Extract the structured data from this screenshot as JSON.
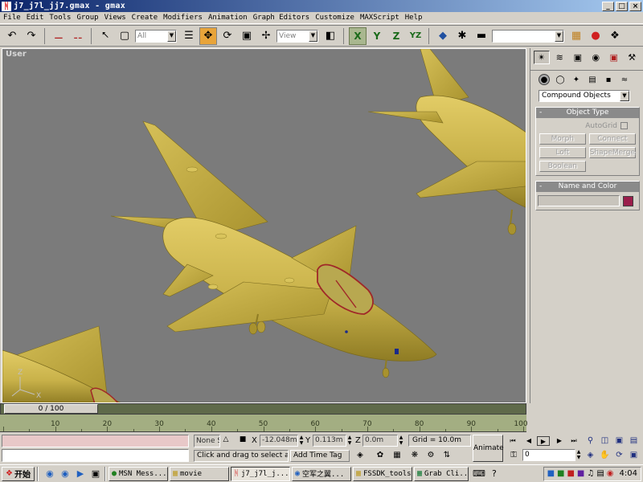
{
  "window": {
    "title": "j7_j7l_jj7.gmax - gmax",
    "minimize": "_",
    "maximize": "□",
    "close": "×"
  },
  "menu": [
    "File",
    "Edit",
    "Tools",
    "Group",
    "Views",
    "Create",
    "Modifiers",
    "Animation",
    "Graph Editors",
    "Customize",
    "MAXScript",
    "Help"
  ],
  "toolbar": {
    "filter_value": "All",
    "refcoord_value": "View",
    "axis_x": "X",
    "axis_y": "Y",
    "axis_z": "Z",
    "axis_yz": "YZ"
  },
  "viewport": {
    "label": "User",
    "axis_x": "X",
    "axis_z": "Z",
    "colors": {
      "background": "#7b7b7b",
      "aircraft": "#c9b24a",
      "aircraft_shadow": "#8f7c24",
      "canopy": "#a02828",
      "marking": "#1a2a8a"
    }
  },
  "command_panel": {
    "category": "Compound Objects",
    "object_type": {
      "title": "Object Type",
      "autogrid": "AutoGrid",
      "buttons": [
        "Morph",
        "Connect",
        "Loft",
        "ShapeMerge",
        "Boolean"
      ]
    },
    "name_color": {
      "title": "Name and Color",
      "name_value": "",
      "color": "#9a1d4a"
    }
  },
  "timeslider": {
    "current": 0,
    "end": 100,
    "label": "0 / 100",
    "ticks": [
      10,
      20,
      30,
      40,
      50,
      60,
      70,
      80,
      90,
      100
    ]
  },
  "status": {
    "selection": "None S",
    "x_label": "X",
    "x_value": "-12.048m",
    "y_label": "Y",
    "y_value": "0.113m",
    "z_label": "Z",
    "z_value": "0.0m",
    "grid": "Grid = 10.0m",
    "prompt": "Click and drag to select and m",
    "time_tag": "Add Time Tag",
    "animate": "Animate",
    "frame_value": "0"
  },
  "taskbar": {
    "start": "开始",
    "tasks": [
      {
        "label": "MSN Mess...",
        "icon": "msn-icon",
        "active": false
      },
      {
        "label": "movie",
        "icon": "folder-icon",
        "active": false
      },
      {
        "label": "j7_j7l_j...",
        "icon": "gmax-icon",
        "active": true
      },
      {
        "label": "空军之翼...",
        "icon": "browser-icon",
        "active": false
      },
      {
        "label": "FSSDK_tools",
        "icon": "folder-icon",
        "active": false
      },
      {
        "label": "Grab Cli...",
        "icon": "grab-icon",
        "active": false
      }
    ],
    "clock": "4:04"
  }
}
